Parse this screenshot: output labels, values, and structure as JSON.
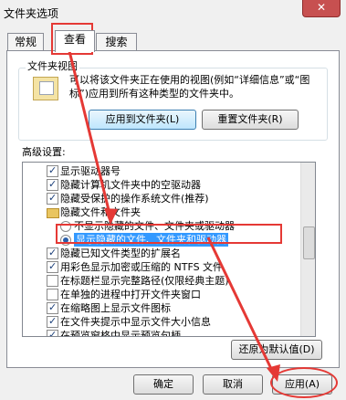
{
  "title": "文件夹选项",
  "tabs": [
    "常规",
    "查看",
    "搜索"
  ],
  "folder_views": {
    "legend": "文件夹视图",
    "description": "可以将该文件夹正在使用的视图(例如“详细信息”或“图标”)应用到所有这种类型的文件夹中。",
    "apply_button": "应用到文件夹(L)",
    "reset_button": "重置文件夹(R)"
  },
  "advanced": {
    "legend": "高级设置:",
    "items": [
      {
        "type": "checkbox",
        "checked": true,
        "label": "显示驱动器号"
      },
      {
        "type": "checkbox",
        "checked": true,
        "label": "隐藏计算机文件夹中的空驱动器"
      },
      {
        "type": "checkbox",
        "checked": true,
        "label": "隐藏受保护的操作系统文件(推荐)"
      },
      {
        "type": "folder",
        "label": "隐藏文件和文件夹"
      },
      {
        "type": "radio",
        "checked": false,
        "label": "不显示隐藏的文件、文件夹或驱动器"
      },
      {
        "type": "radio",
        "checked": true,
        "label": "显示隐藏的文件、文件夹和驱动器"
      },
      {
        "type": "checkbox",
        "checked": true,
        "label": "隐藏已知文件类型的扩展名"
      },
      {
        "type": "checkbox",
        "checked": true,
        "label": "用彩色显示加密或压缩的 NTFS 文件"
      },
      {
        "type": "checkbox",
        "checked": false,
        "label": "在标题栏显示完整路径(仅限经典主题)"
      },
      {
        "type": "checkbox",
        "checked": false,
        "label": "在单独的进程中打开文件夹窗口"
      },
      {
        "type": "checkbox",
        "checked": true,
        "label": "在缩略图上显示文件图标"
      },
      {
        "type": "checkbox",
        "checked": true,
        "label": "在文件夹提示中显示文件大小信息"
      },
      {
        "type": "checkbox",
        "checked": true,
        "label": "在预览窗格中显示预览句柄"
      }
    ],
    "restore_button": "还原为默认值(D)"
  },
  "footer": {
    "ok": "确定",
    "cancel": "取消",
    "apply": "应用(A)"
  },
  "colors": {
    "highlight": "#3399ff",
    "annotation_red": "#e53935",
    "close_button": "#c75050"
  }
}
